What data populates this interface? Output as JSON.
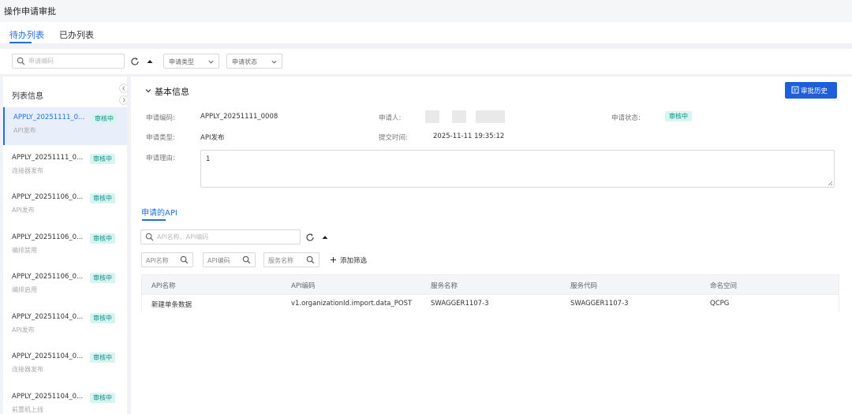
{
  "page": {
    "title": "操作申请审批"
  },
  "tabs": [
    {
      "label": "待办列表",
      "active": true
    },
    {
      "label": "已办列表",
      "active": false
    }
  ],
  "filters": {
    "search_placeholder": "申请编码",
    "type_select": "申请类型",
    "status_select": "申请状态"
  },
  "sidebar": {
    "title": "列表信息",
    "items": [
      {
        "code": "APPLY_20251111_0...",
        "type": "API发布",
        "status": "审核中",
        "active": true
      },
      {
        "code": "APPLY_20251111_0...",
        "type": "连接器发布",
        "status": "审核中"
      },
      {
        "code": "APPLY_20251106_0...",
        "type": "API发布",
        "status": "审核中"
      },
      {
        "code": "APPLY_20251106_0...",
        "type": "编排禁用",
        "status": "审核中"
      },
      {
        "code": "APPLY_20251106_0...",
        "type": "编排启用",
        "status": "审核中"
      },
      {
        "code": "APPLY_20251104_0...",
        "type": "API发布",
        "status": "审核中"
      },
      {
        "code": "APPLY_20251104_0...",
        "type": "连接器发布",
        "status": "审核中"
      },
      {
        "code": "APPLY_20251104_0...",
        "type": "前置机上线",
        "status": "审核中"
      }
    ]
  },
  "detail": {
    "section_title": "基本信息",
    "history_button": "审批历史",
    "fields": {
      "code_label": "申请编码:",
      "code_value": "APPLY_20251111_0008",
      "applicant_label": "申请人:",
      "status_label": "申请状态:",
      "status_value": "审核中",
      "type_label": "申请类型:",
      "type_value": "API发布",
      "time_label": "提交时间:",
      "time_value": "2025-11-11 19:35:12",
      "reason_label": "申请理由:",
      "reason_value": "1"
    }
  },
  "api_section": {
    "tab_label": "申请的API",
    "search_placeholder": "API名称、API编码",
    "mini_filters": [
      "API名称",
      "API编码",
      "服务名称"
    ],
    "add_filter": "添加筛选",
    "columns": [
      "API名称",
      "API编码",
      "服务名称",
      "服务代码",
      "命名空间"
    ],
    "rows": [
      [
        "新建单条数据",
        "v1.organizationId.import.data_POST",
        "SWAGGER1107-3",
        "SWAGGER1107-3",
        "QCPG"
      ]
    ]
  },
  "colors": {
    "accent": "#1f6feb",
    "button": "#1f5ed9",
    "badge_bg": "#d6f5f0",
    "badge_text": "#0f8a8a"
  },
  "icons": [
    "search-icon",
    "refresh-icon",
    "collapse-up-icon",
    "chevron-down-icon",
    "chevron-left-icon",
    "chevron-right-icon",
    "history-icon",
    "plus-icon"
  ]
}
